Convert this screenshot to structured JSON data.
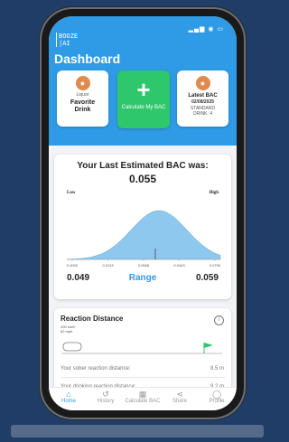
{
  "status_bar": {
    "icons": "▂▄▆ ◉ ▭"
  },
  "app": {
    "logo_line1": "BOOZE",
    "logo_line2": "|AI",
    "title": "Dashboard"
  },
  "quick_cards": {
    "favorite": {
      "small": "Liquor",
      "title": "Favorite Drink"
    },
    "calculate": {
      "label": "Calculate My BAC"
    },
    "latest": {
      "title": "Latest BAC",
      "date": "02/08/2025",
      "detail": "STANDARD DRINK: 4"
    }
  },
  "bac_card": {
    "title": "Your Last Estimated BAC was:",
    "value": "0.055",
    "low_label": "Low",
    "high_label": "High",
    "range_low": "0.049",
    "range_label": "Range",
    "range_high": "0.059"
  },
  "chart_data": {
    "type": "area",
    "x_ticks": [
      "0.0000",
      "0.0113",
      "0.0565",
      "0.0163",
      "0.0790"
    ],
    "fill_color": "#8fc8ef"
  },
  "reaction": {
    "title": "Reaction Distance",
    "speed_kmh": "100 km/h",
    "speed_mph": "62 mph",
    "sober_label": "Your sober reaction distance:",
    "sober_value": "8.5 m",
    "drinking_label": "Your drinking reaction distance:",
    "drinking_value": "9.2 m"
  },
  "nav": {
    "items": [
      {
        "label": "Home",
        "icon": "home-icon"
      },
      {
        "label": "History",
        "icon": "history-icon"
      },
      {
        "label": "Calculate BAC",
        "icon": "calculator-icon"
      },
      {
        "label": "Share",
        "icon": "share-icon"
      },
      {
        "label": "Profile",
        "icon": "profile-icon"
      }
    ]
  },
  "colors": {
    "primary": "#2f9be6",
    "green": "#2ec76b",
    "orange": "#e08a4e"
  }
}
